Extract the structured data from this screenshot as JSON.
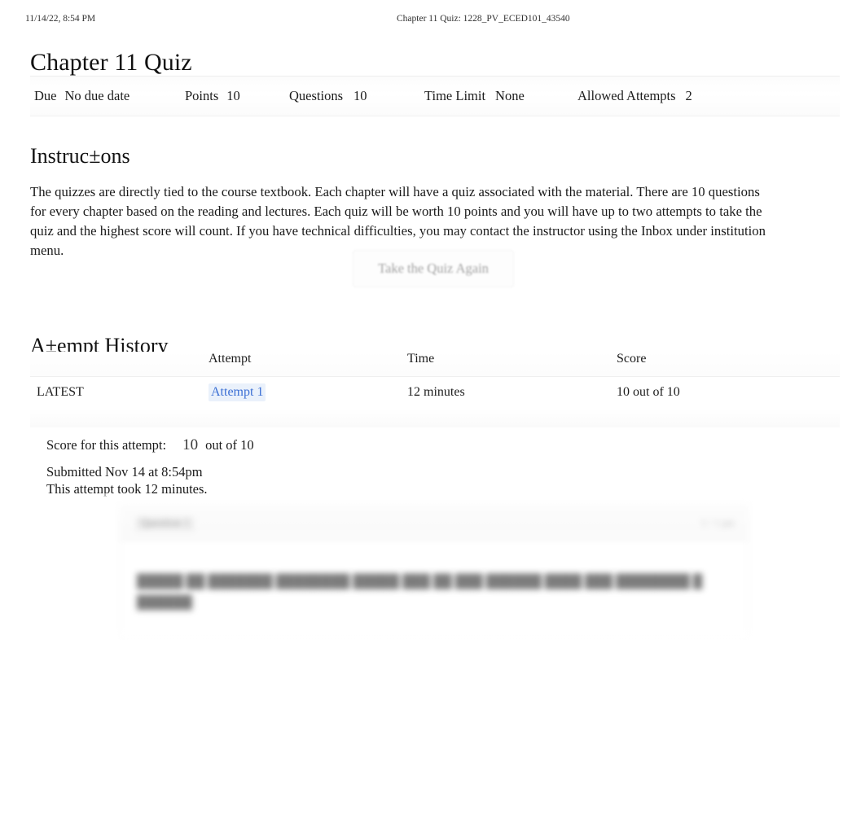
{
  "print_header": {
    "timestamp": "11/14/22, 8:54 PM",
    "document_title": "Chapter 11 Quiz: 1228_PV_ECED101_43540"
  },
  "page_title": "Chapter 11 Quiz",
  "quiz_meta": {
    "due_label": "Due",
    "due_value": "No due date",
    "points_label": "Points",
    "points_value": "10",
    "questions_label": "Questions",
    "questions_value": "10",
    "time_limit_label": "Time Limit",
    "time_limit_value": "None",
    "allowed_attempts_label": "Allowed Attempts",
    "allowed_attempts_value": "2"
  },
  "instructions": {
    "heading": "Instruc±ons",
    "body": "The quizzes are directly tied to the course textbook. Each chapter will have a quiz associated with the material. There are 10 questions for every chapter based on the reading and lectures. Each quiz will be worth 10 points and you will have up to two attempts to take the quiz and the highest score will count. If you have technical difficulties, you may contact the instructor using the Inbox under institution menu."
  },
  "take_quiz_button": {
    "label": "Take the Quiz Again"
  },
  "attempt_history": {
    "heading": "A±empt History",
    "columns": [
      "",
      "Attempt",
      "Time",
      "Score"
    ],
    "rows": [
      {
        "kept": "LATEST",
        "attempt": "Attempt 1",
        "time": "12 minutes",
        "score": "10 out of 10"
      }
    ]
  },
  "score_summary": {
    "score_label": "Score for this attempt:",
    "score_value": "10",
    "score_out_of": "out of 10",
    "submitted": "Submitted Nov 14 at 8:54pm",
    "duration": "This attempt took 12 minutes."
  },
  "question_panel": {
    "question_label": "Question 1",
    "points": "1 / 1 pts",
    "question_text": "█████ ██ ███████ ████████ █████ ███ ██ ███ ██████ ████ ███ ████████ █ ██████"
  },
  "colors": {
    "link": "#3b6fd4",
    "link_highlight": "#eaf1fb",
    "text": "#1a1a1a",
    "muted": "#9b9b9b",
    "background": "#ffffff"
  }
}
